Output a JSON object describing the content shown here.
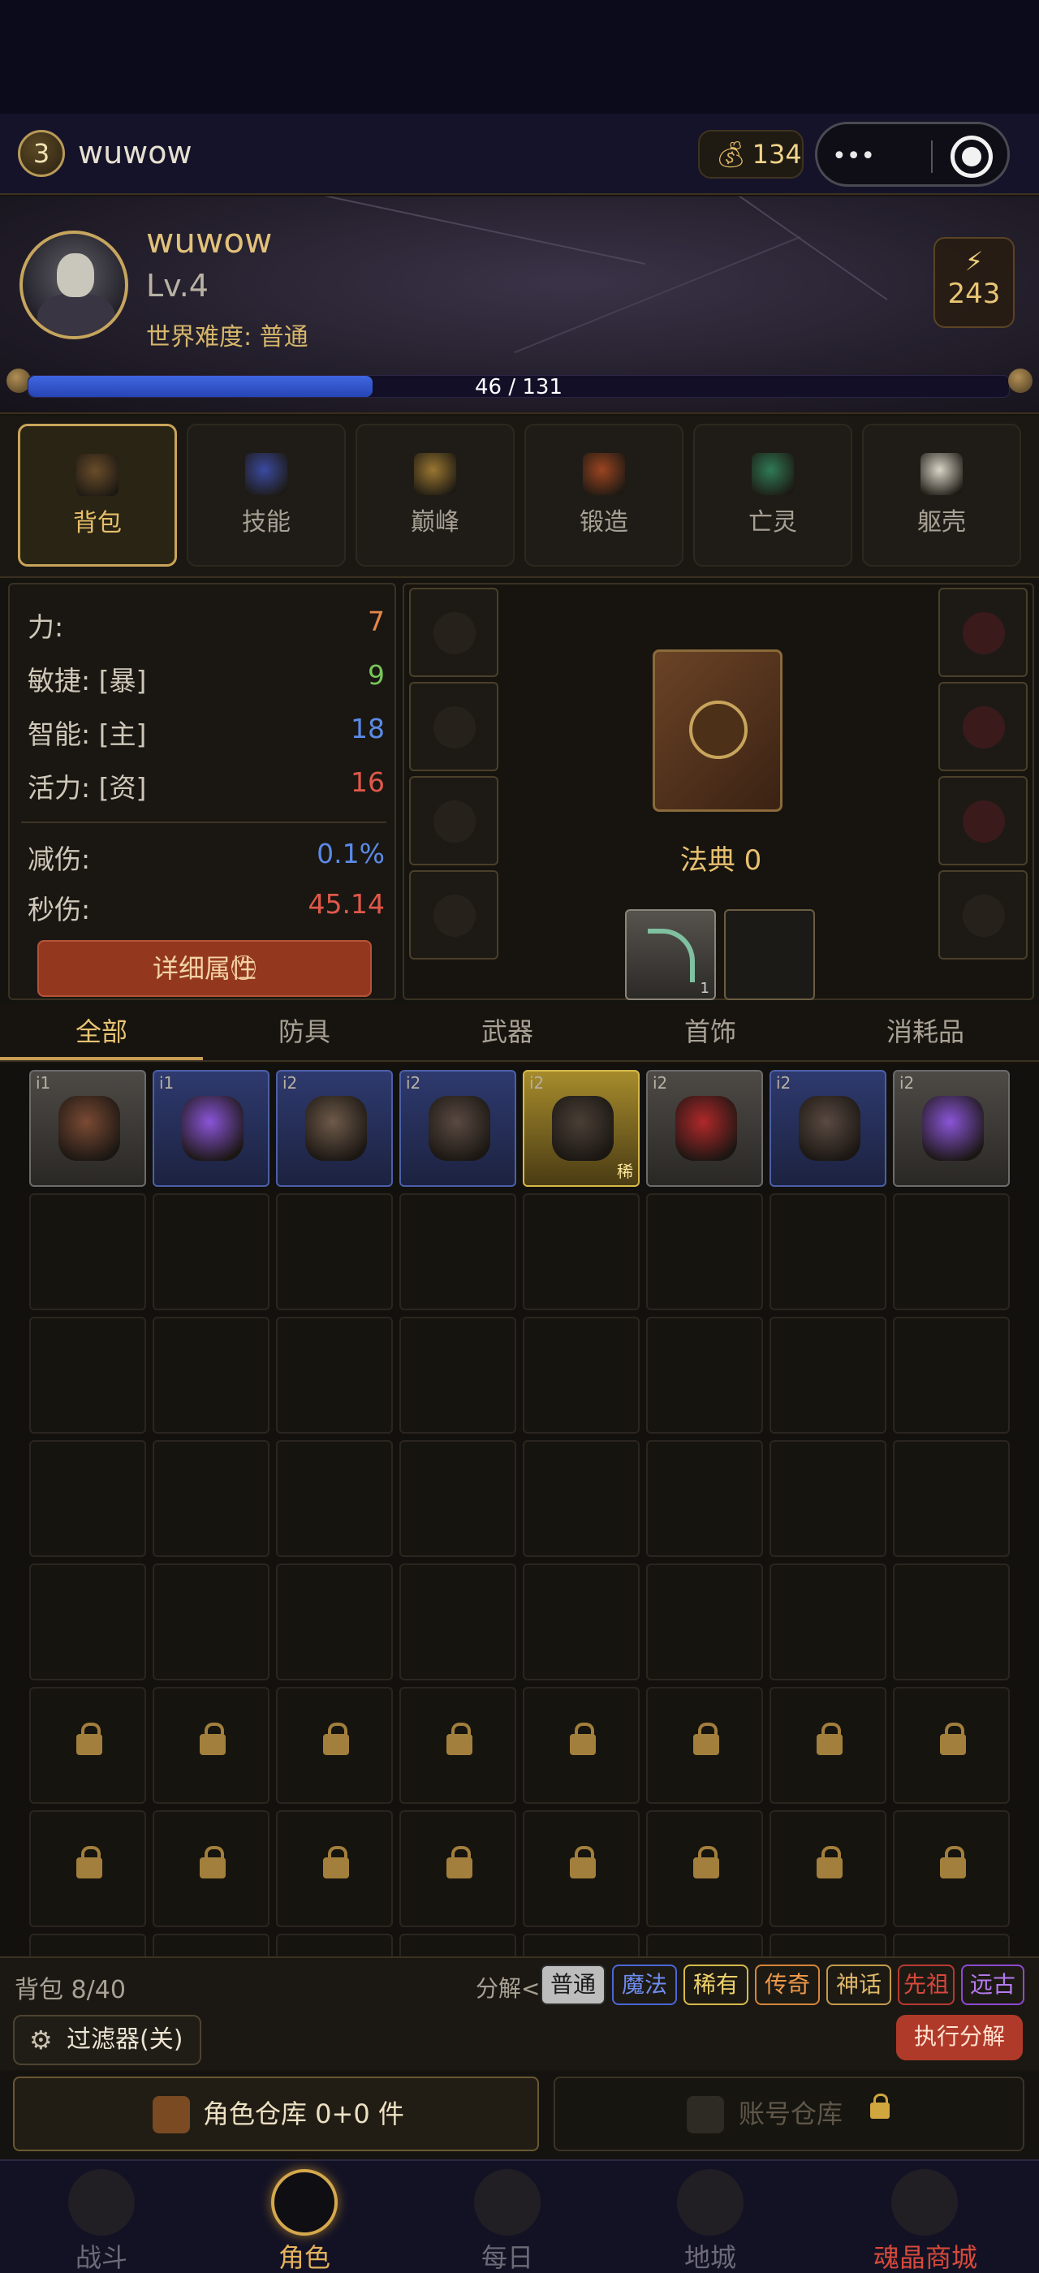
{
  "topbar": {
    "level": "3",
    "name": "wuwow",
    "gold": "134",
    "capsule_text": "•••"
  },
  "hero": {
    "name": "wuwow",
    "level": "Lv.4",
    "difficulty": "世界难度: 普通",
    "energy": "243",
    "xp_current": 46,
    "xp_max": 131,
    "xp_text": "46 / 131"
  },
  "tabs": [
    {
      "label": "背包",
      "icon": "backpack-icon",
      "color": "#6a4c2a"
    },
    {
      "label": "技能",
      "icon": "skill-crystal-icon",
      "color": "#3b4aa0"
    },
    {
      "label": "巅峰",
      "icon": "paragon-star-icon",
      "color": "#9a7630"
    },
    {
      "label": "锻造",
      "icon": "forge-chest-icon",
      "color": "#9b4420"
    },
    {
      "label": "亡灵",
      "icon": "undead-orb-icon",
      "color": "#2f7a55"
    },
    {
      "label": "躯壳",
      "icon": "bone-icon",
      "color": "#d9d4c6"
    }
  ],
  "stats": {
    "primary": [
      {
        "label": "力:",
        "value": "7",
        "color": "#e5874c"
      },
      {
        "label": "敏捷: [暴]",
        "value": "9",
        "color": "#79c75a"
      },
      {
        "label": "智能: [主]",
        "value": "18",
        "color": "#5b8ae6"
      },
      {
        "label": "活力: [资]",
        "value": "16",
        "color": "#e0584a"
      }
    ],
    "secondary": [
      {
        "label": "减伤:",
        "value": "0.1%",
        "color": "#5b8ae6"
      },
      {
        "label": "秒伤:",
        "value": "45.14",
        "color": "#e0584a"
      }
    ],
    "detail_button": "详细属性⃝"
  },
  "equipment": {
    "book_label": "法典 0",
    "weapon_count": "1"
  },
  "categories": [
    "全部",
    "防具",
    "武器",
    "首饰",
    "消耗品"
  ],
  "inventory": {
    "items": [
      {
        "tier": "i1",
        "rarity": "normal",
        "icon": "helmet-icon",
        "art": "#7a4a34"
      },
      {
        "tier": "i1",
        "rarity": "magic",
        "icon": "skull-gem-icon",
        "art": "#8a55d8"
      },
      {
        "tier": "i2",
        "rarity": "magic",
        "icon": "dagger-icon",
        "art": "#6e5a4a"
      },
      {
        "tier": "i2",
        "rarity": "magic",
        "icon": "leg-armor-icon",
        "art": "#5a4a42"
      },
      {
        "tier": "i2",
        "rarity": "rare",
        "tag": "稀",
        "icon": "leg-armor-icon",
        "art": "#4a3f36"
      },
      {
        "tier": "i2",
        "rarity": "normal",
        "icon": "ruby-ring-icon",
        "art": "#b0282a"
      },
      {
        "tier": "i2",
        "rarity": "magic",
        "icon": "leg-armor-icon",
        "art": "#5a4a42"
      },
      {
        "tier": "i2",
        "rarity": "normal",
        "icon": "skull-gem-icon",
        "art": "#8a55d8"
      }
    ]
  },
  "controls": {
    "bag_count": "背包 8/40",
    "salvage_label": "分解<",
    "rarity_buttons": [
      {
        "label": "普通",
        "color": "#2a2a2a",
        "text": "#1a1a1a",
        "bg": "#bdbdbd"
      },
      {
        "label": "魔法",
        "color": "#4a67d6",
        "text": "#6f8cf0",
        "bg": "#1d1a14"
      },
      {
        "label": "稀有",
        "color": "#d6b94a",
        "text": "#f0d26a",
        "bg": "#1d1a14"
      },
      {
        "label": "传奇",
        "color": "#d5853a",
        "text": "#f09a4a",
        "bg": "#1d1a14"
      },
      {
        "label": "神话",
        "color": "#c49a4a",
        "text": "#e0b86a",
        "bg": "#1d1a14"
      },
      {
        "label": "先祖",
        "color": "#b73a32",
        "text": "#d8473c",
        "bg": "#1d1a14"
      },
      {
        "label": "远古",
        "color": "#8e4ad0",
        "text": "#b67af0",
        "bg": "#1d1a14"
      }
    ],
    "filter_label": "过滤器(关)",
    "execute_label": "执行分解"
  },
  "stash": {
    "character": "角色仓库 0+0 件",
    "account": "账号仓库"
  },
  "nav": [
    {
      "label": "战斗",
      "icon": "battle-icon"
    },
    {
      "label": "角色",
      "icon": "character-icon"
    },
    {
      "label": "每日",
      "icon": "daily-icon"
    },
    {
      "label": "地城",
      "icon": "dungeon-icon"
    },
    {
      "label": "魂晶商城",
      "icon": "soul-shop-icon"
    }
  ],
  "colors": {
    "accent_gold": "#e8bf6a",
    "xp_blue": "#3f66e0",
    "danger_red": "#b03a2a"
  }
}
